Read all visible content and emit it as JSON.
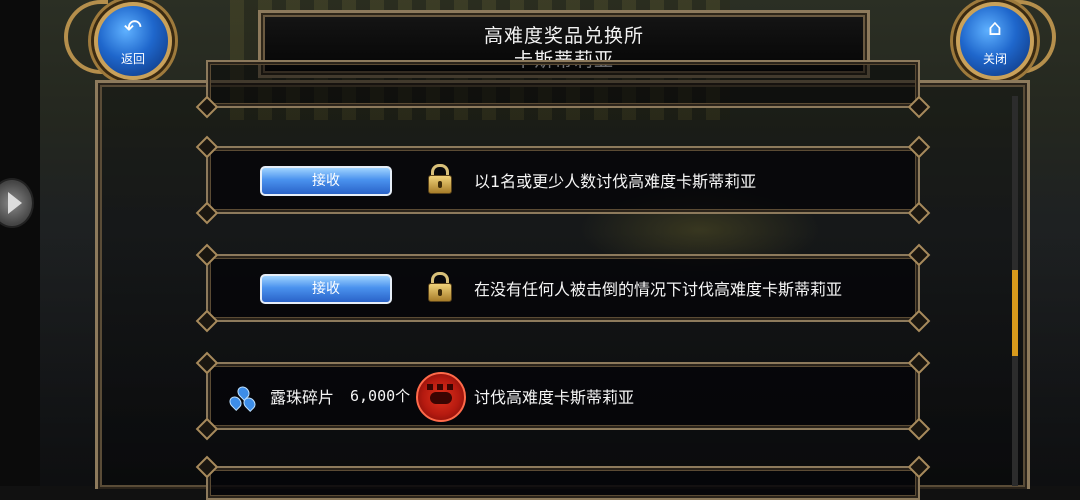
{
  "header": {
    "title_line1": "高难度奖品兑换所",
    "title_line2": "卡斯蒂莉亚",
    "back_label": "返回",
    "close_label": "关闭"
  },
  "rewards": [
    {
      "button_label": "接收",
      "locked": true,
      "condition": "以1名或更少人数讨伐高难度卡斯蒂莉亚"
    },
    {
      "button_label": "接收",
      "locked": true,
      "condition": "在没有任何人被击倒的情况下讨伐高难度卡斯蒂莉亚"
    },
    {
      "item_name": "露珠碎片",
      "item_quantity": "6,000个",
      "condition": "讨伐高难度卡斯蒂莉亚"
    }
  ],
  "colors": {
    "frame_gold": "#8d7a5c",
    "button_blue": "#4a92ee",
    "scroll_thumb": "#d89a1c",
    "boss_red": "#c4200f"
  },
  "icons": [
    "back-arrow-icon",
    "home-icon",
    "lock-icon",
    "dew-shard-icon",
    "boss-emblem-icon"
  ]
}
